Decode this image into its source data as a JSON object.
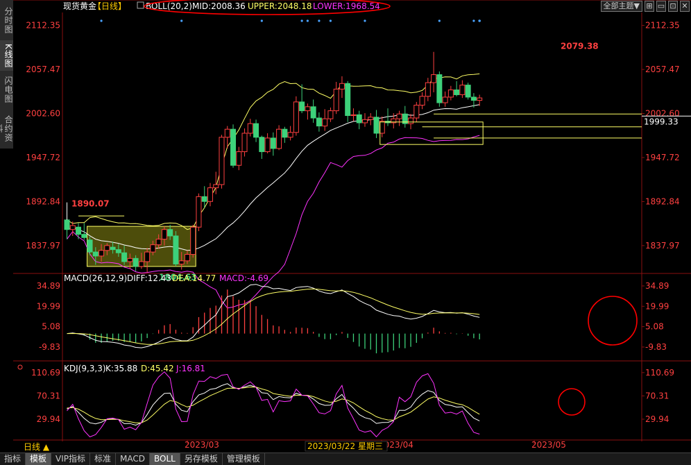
{
  "sidebar": {
    "tabs": [
      "分时图",
      "K线图",
      "闪电图",
      "合约资料"
    ],
    "active": 1
  },
  "toolbar": {
    "theme": "全部主题",
    "theme_arrow": "▼"
  },
  "header": {
    "symbol": "现货黄金",
    "period": "【日线】"
  },
  "boll": {
    "label": "BOLL(20,2)",
    "mid": "MID:2008.36",
    "upper": "UPPER:2048.18",
    "lower": "LOWER:1968.54"
  },
  "macd": {
    "label": "MACD(26,12,9)",
    "diff": "DIFF:12.43",
    "dea": "DEA:14.77",
    "macd": "MACD:-4.69"
  },
  "kdj": {
    "label": "KDJ(9,3,3)",
    "k": "K:35.88",
    "d": "D:45.42",
    "j": "J:16.81"
  },
  "bottom": {
    "period": "日线 ▲",
    "cursor_date": "2023/03/22 星期三",
    "tabs": [
      "指标",
      "模板",
      "VIP指标",
      "标准",
      "MACD",
      "BOLL",
      "另存模板",
      "管理模板"
    ],
    "active": [
      1,
      5
    ]
  },
  "colors": {
    "up": "#ff4040",
    "down": "#3dd17a",
    "mid": "#ffffff",
    "upper": "#ffff66",
    "lower": "#ff33ff",
    "annot": "#ff0000"
  },
  "chart_data": [
    {
      "type": "candlestick",
      "ylim": [
        1805,
        2125
      ],
      "yticks": [
        "2112.35",
        "2057.47",
        "2002.60",
        "1947.72",
        "1892.84",
        "1837.97"
      ],
      "xticks": [
        "2023/03",
        "2023/04",
        "2023/05"
      ],
      "price_tag": "1999.33",
      "annotations": [
        {
          "label": "1890.07"
        },
        {
          "label": "1804.63"
        },
        {
          "label": "2079.38"
        }
      ],
      "ohlc": [
        [
          1870,
          1874,
          1846,
          1858
        ],
        [
          1858,
          1868,
          1850,
          1863
        ],
        [
          1861,
          1866,
          1846,
          1852
        ],
        [
          1852,
          1866,
          1845,
          1848
        ],
        [
          1845,
          1849,
          1826,
          1830
        ],
        [
          1830,
          1836,
          1814,
          1825
        ],
        [
          1825,
          1840,
          1818,
          1832
        ],
        [
          1832,
          1841,
          1826,
          1838
        ],
        [
          1836,
          1843,
          1828,
          1833
        ],
        [
          1833,
          1840,
          1824,
          1829
        ],
        [
          1829,
          1838,
          1814,
          1818
        ],
        [
          1818,
          1828,
          1809,
          1822
        ],
        [
          1822,
          1826,
          1806,
          1812
        ],
        [
          1812,
          1829,
          1809,
          1818
        ],
        [
          1818,
          1835,
          1804.63,
          1830
        ],
        [
          1830,
          1844,
          1826,
          1839
        ],
        [
          1839,
          1852,
          1834,
          1846
        ],
        [
          1846,
          1862,
          1838,
          1858
        ],
        [
          1858,
          1864,
          1845,
          1850
        ],
        [
          1850,
          1856,
          1812,
          1815
        ],
        [
          1815,
          1830,
          1808,
          1819
        ],
        [
          1819,
          1832,
          1815,
          1827
        ],
        [
          1827,
          1864,
          1823,
          1861
        ],
        [
          1861,
          1903,
          1856,
          1899
        ],
        [
          1899,
          1912,
          1885,
          1893
        ],
        [
          1893,
          1916,
          1887,
          1910
        ],
        [
          1910,
          1930,
          1902,
          1914
        ],
        [
          1914,
          1976,
          1909,
          1973
        ],
        [
          1973,
          1987,
          1959,
          1983
        ],
        [
          1983,
          1989,
          1935,
          1938
        ],
        [
          1938,
          1961,
          1932,
          1955
        ],
        [
          1955,
          1984,
          1949,
          1978
        ],
        [
          1978,
          1996,
          1974,
          1990
        ],
        [
          1990,
          1995,
          1967,
          1973
        ],
        [
          1973,
          1975,
          1946,
          1955
        ],
        [
          1955,
          1978,
          1953,
          1972
        ],
        [
          1972,
          1979,
          1950,
          1959
        ],
        [
          1959,
          1988,
          1957,
          1983
        ],
        [
          1983,
          1986,
          1966,
          1973
        ],
        [
          1973,
          1987,
          1969,
          1979
        ],
        [
          1979,
          2024,
          1975,
          2017
        ],
        [
          2017,
          2039,
          2003,
          2006
        ],
        [
          2006,
          2015,
          1995,
          2011
        ],
        [
          2011,
          2020,
          1991,
          1997
        ],
        [
          1997,
          2004,
          1980,
          1987
        ],
        [
          1987,
          2008,
          1981,
          1996
        ],
        [
          1996,
          2010,
          1992,
          2006
        ],
        [
          2006,
          2042,
          2002,
          2033
        ],
        [
          2033,
          2049,
          2022,
          2040
        ],
        [
          2040,
          2043,
          1992,
          2000
        ],
        [
          2000,
          2009,
          1993,
          2001
        ],
        [
          2001,
          2006,
          1983,
          1991
        ],
        [
          1991,
          2003,
          1986,
          1995
        ],
        [
          1995,
          2003,
          1988,
          1998
        ],
        [
          1998,
          2007,
          1972,
          1978
        ],
        [
          1978,
          1999,
          1973,
          1993
        ],
        [
          1993,
          2009,
          1987,
          1991
        ],
        [
          1991,
          2003,
          1984,
          1996
        ],
        [
          1996,
          2006,
          1987,
          2002
        ],
        [
          2002,
          2012,
          1985,
          1990
        ],
        [
          1990,
          2002,
          1983,
          1997
        ],
        [
          1997,
          2017,
          1992,
          2013
        ],
        [
          2013,
          2029,
          2008,
          2024
        ],
        [
          2024,
          2047,
          2018,
          2041
        ],
        [
          2041,
          2079.38,
          2029,
          2051
        ],
        [
          2051,
          2055,
          2011,
          2016
        ],
        [
          2016,
          2030,
          2011,
          2023
        ],
        [
          2023,
          2037,
          2019,
          2032
        ],
        [
          2032,
          2043,
          2024,
          2026
        ],
        [
          2026,
          2044,
          2022,
          2038
        ],
        [
          2038,
          2041,
          2020,
          2023
        ],
        [
          2023,
          2028,
          2010,
          2019
        ],
        [
          2019,
          2026,
          2012,
          2022
        ]
      ]
    },
    {
      "type": "macd",
      "ylim": [
        -20,
        43
      ],
      "yticks": [
        "34.89",
        "19.99",
        "5.08",
        "-9.83"
      ]
    },
    {
      "type": "kdj",
      "ylim": [
        -5,
        125
      ],
      "yticks": [
        "110.69",
        "70.31",
        "29.94"
      ]
    }
  ]
}
